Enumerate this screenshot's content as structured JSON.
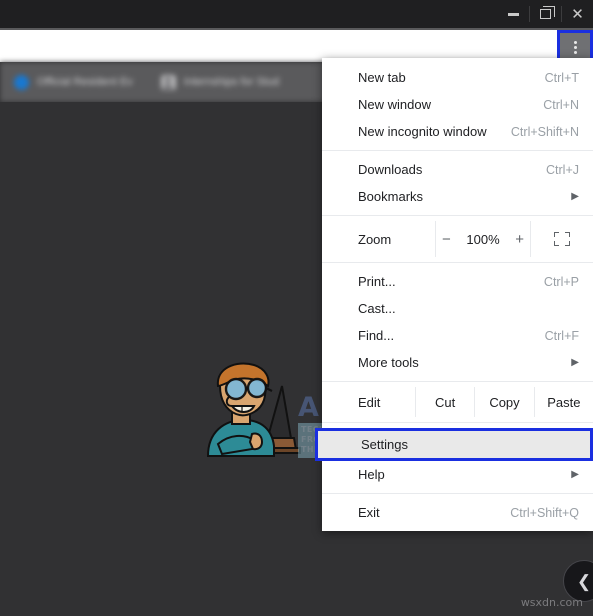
{
  "window": {
    "controls": {
      "minimize": "minimize-button",
      "restore": "restore-button",
      "close": "✕"
    }
  },
  "toolbar": {
    "bookmark_star": "☆",
    "menu_button": "chrome-menu-button"
  },
  "bookmarks": {
    "items": [
      {
        "label": "Official Resident Ev"
      },
      {
        "label": "Internships for Stud"
      }
    ]
  },
  "menu": {
    "items": [
      {
        "label": "New tab",
        "accel": "Ctrl+T"
      },
      {
        "label": "New window",
        "accel": "Ctrl+N"
      },
      {
        "label": "New incognito window",
        "accel": "Ctrl+Shift+N"
      },
      {
        "label": "Downloads",
        "accel": "Ctrl+J"
      },
      {
        "label": "Bookmarks",
        "accel": "",
        "caret": "▶"
      },
      {
        "label": "Print...",
        "accel": "Ctrl+P"
      },
      {
        "label": "Cast...",
        "accel": ""
      },
      {
        "label": "Find...",
        "accel": "Ctrl+F"
      },
      {
        "label": "More tools",
        "accel": "",
        "caret": "▶"
      },
      {
        "label": "Settings",
        "accel": ""
      },
      {
        "label": "Help",
        "accel": "",
        "caret": "▶"
      },
      {
        "label": "Exit",
        "accel": "Ctrl+Shift+Q"
      }
    ],
    "zoom": {
      "label": "Zoom",
      "minus": "−",
      "value": "100%",
      "plus": "+",
      "fullscreen": "fullscreen-icon"
    },
    "edit": {
      "label": "Edit",
      "cut": "Cut",
      "copy": "Copy",
      "paste": "Paste"
    }
  },
  "watermark": {
    "brand": "APPUALS",
    "tagline_line1": "TECH HOW-TO'S FROM",
    "tagline_line2": "THE EXPERTS!",
    "footer": "wsxdn.com"
  },
  "side_button": {
    "glyph": "❮"
  },
  "colors": {
    "highlight_blue": "#1a2fe0",
    "page_background": "#313133",
    "titlebar": "#1f1f21",
    "bookmarkbar": "#5a5a5c",
    "menu_background": "#ffffff",
    "menu_text": "#202124",
    "accel_text": "#9aa0a6"
  }
}
